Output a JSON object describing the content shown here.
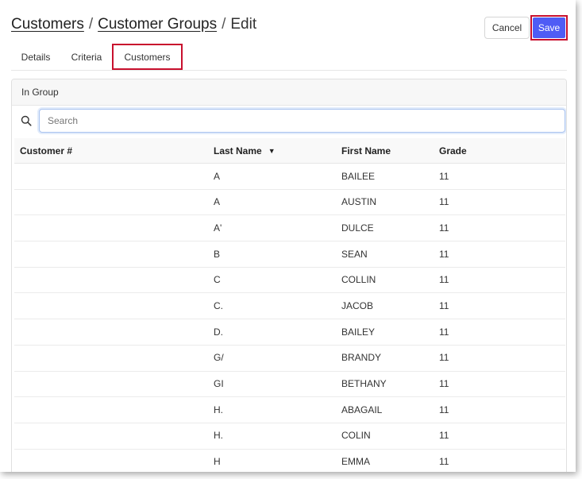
{
  "breadcrumb": {
    "items": [
      "Customers",
      "Customer Groups"
    ],
    "separator": "/",
    "current": "Edit"
  },
  "actions": {
    "cancel_label": "Cancel",
    "save_label": "Save"
  },
  "tabs": [
    {
      "label": "Details",
      "active": false
    },
    {
      "label": "Criteria",
      "active": false
    },
    {
      "label": "Customers",
      "active": true
    }
  ],
  "panel": {
    "title": "In Group",
    "search": {
      "placeholder": "Search",
      "value": ""
    },
    "columns": [
      "Customer #",
      "Last Name",
      "First Name",
      "Grade"
    ],
    "sort": {
      "column": "Last Name",
      "direction": "desc"
    },
    "rows": [
      {
        "customer_no": "",
        "last_name": "A",
        "first_name": "BAILEE",
        "grade": "11"
      },
      {
        "customer_no": "",
        "last_name": "A",
        "first_name": "AUSTIN",
        "grade": "11"
      },
      {
        "customer_no": "",
        "last_name": "A'",
        "first_name": "DULCE",
        "grade": "11"
      },
      {
        "customer_no": "",
        "last_name": "B",
        "first_name": "SEAN",
        "grade": "11"
      },
      {
        "customer_no": "",
        "last_name": "C",
        "first_name": "COLLIN",
        "grade": "11"
      },
      {
        "customer_no": "",
        "last_name": "C.",
        "first_name": "JACOB",
        "grade": "11"
      },
      {
        "customer_no": "",
        "last_name": "D.",
        "first_name": "BAILEY",
        "grade": "11"
      },
      {
        "customer_no": "",
        "last_name": "G/",
        "first_name": "BRANDY",
        "grade": "11"
      },
      {
        "customer_no": "",
        "last_name": "GI",
        "first_name": "BETHANY",
        "grade": "11"
      },
      {
        "customer_no": "",
        "last_name": "H.",
        "first_name": "ABAGAIL",
        "grade": "11"
      },
      {
        "customer_no": "",
        "last_name": "H.",
        "first_name": "COLIN",
        "grade": "11"
      },
      {
        "customer_no": "",
        "last_name": "H",
        "first_name": "EMMA",
        "grade": "11"
      }
    ]
  },
  "colors": {
    "accent": "#4f5cf5",
    "highlight": "#c8102e"
  }
}
